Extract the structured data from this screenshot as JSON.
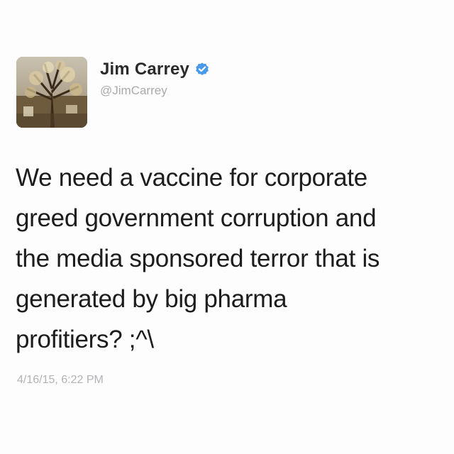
{
  "tweet": {
    "author": {
      "display_name": "Jim Carrey",
      "handle": "@JimCarrey",
      "verified": true,
      "avatar_icon": "profile-photo"
    },
    "text": "We need a vaccine for corporate\ngreed government corruption and\nthe media sponsored terror that is\ngenerated by big pharma\nprofitiers? ;^\\",
    "timestamp": "4/16/15, 6:22 PM"
  },
  "colors": {
    "background": "#fdfdfd",
    "name": "#2a2a2a",
    "handle": "#a7a9ac",
    "body_text": "#1c1c1c",
    "timestamp": "#b1b3b6",
    "verified_badge": "#4a99e9"
  }
}
